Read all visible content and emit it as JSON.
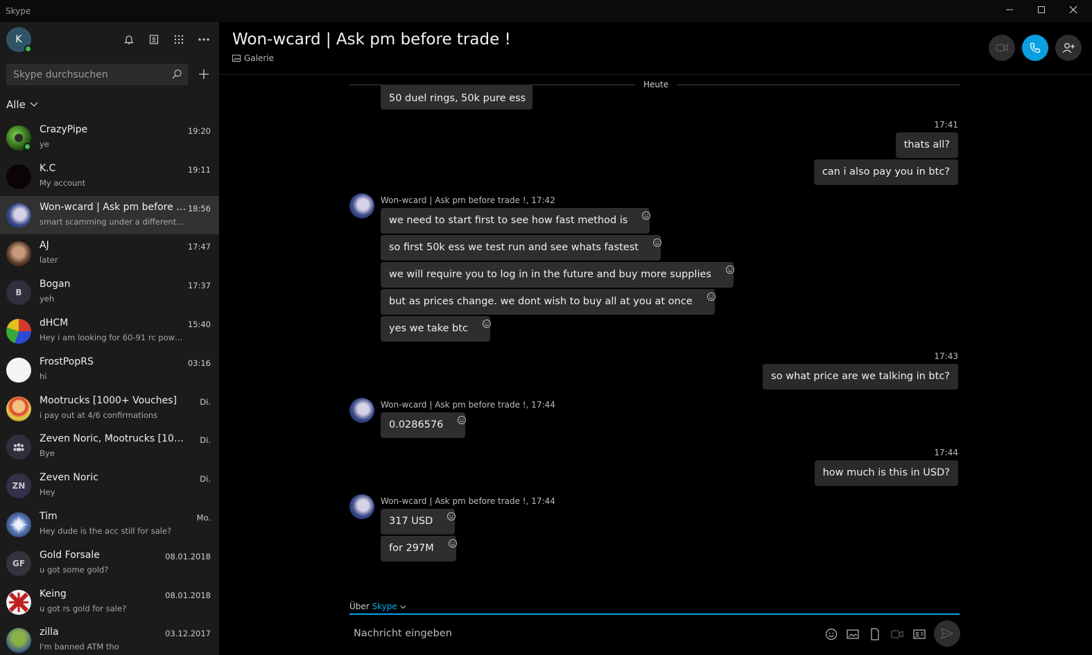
{
  "window": {
    "title": "Skype"
  },
  "sidebar": {
    "me_initial": "K",
    "search_placeholder": "Skype durchsuchen",
    "filter_label": "Alle",
    "contacts": [
      {
        "name": "CrazyPipe",
        "preview": "ye",
        "time": "19:20"
      },
      {
        "name": "K.C",
        "preview": "My account",
        "time": "19:11"
      },
      {
        "name": "Won-wcard | Ask pm before trade !",
        "preview": "smart scamming under a different skype name",
        "time": "18:56"
      },
      {
        "name": "AJ",
        "preview": "later",
        "time": "17:47"
      },
      {
        "name": "Bogan",
        "preview": "yeh",
        "time": "17:37",
        "initials": "B"
      },
      {
        "name": "dHCM",
        "preview": "Hey i am looking for 60-91 rc powerlvl",
        "time": "15:40"
      },
      {
        "name": "FrostPopRS",
        "preview": "hi",
        "time": "03:16"
      },
      {
        "name": "Mootrucks [1000+ Vouches]",
        "preview": "i pay out at 4/6 confirmations",
        "time": "Di."
      },
      {
        "name": "Zeven Noric, Mootrucks [1000+ Vouches]",
        "preview": "Bye",
        "time": "Di."
      },
      {
        "name": "Zeven Noric",
        "preview": "Hey",
        "time": "Di.",
        "initials": "ZN"
      },
      {
        "name": "Tim",
        "preview": "Hey dude is the acc still for sale?",
        "time": "Mo."
      },
      {
        "name": "Gold Forsale",
        "preview": "u got some gold?",
        "time": "08.01.2018",
        "initials": "GF"
      },
      {
        "name": "Keing",
        "preview": "u got rs gold for sale?",
        "time": "08.01.2018"
      },
      {
        "name": "zilla",
        "preview": "I'm banned ATM tho",
        "time": "03.12.2017"
      }
    ]
  },
  "chat": {
    "title": "Won-wcard | Ask pm before trade !",
    "gallery_label": "Galerie",
    "day_label": "Heute",
    "partial_message": "50 duel rings, 50k pure ess",
    "groups": [
      {
        "dir": "out",
        "time": "17:41",
        "messages": [
          "thats all?",
          "can i also pay you in btc?"
        ]
      },
      {
        "dir": "in",
        "meta": "Won-wcard | Ask pm before trade !, 17:42",
        "messages": [
          "we need to start first to see how fast method is",
          "so first 50k ess we test run and see whats fastest",
          "we will require you to log in in the future and buy more supplies",
          "but as prices change. we dont wish to buy all at you at once",
          "yes we take btc"
        ]
      },
      {
        "dir": "out",
        "time": "17:43",
        "messages": [
          "so what price are we talking in btc?"
        ]
      },
      {
        "dir": "in",
        "meta": "Won-wcard | Ask pm before trade !, 17:44",
        "messages": [
          "0.0286576"
        ]
      },
      {
        "dir": "out",
        "time": "17:44",
        "messages": [
          "how much is this in USD?"
        ]
      },
      {
        "dir": "in",
        "meta": "Won-wcard | Ask pm before trade !, 17:44",
        "messages": [
          "317 USD",
          "for 297M"
        ]
      }
    ]
  },
  "composer": {
    "via_prefix": "Über",
    "via_service": "Skype",
    "placeholder": "Nachricht eingeben"
  },
  "colors": {
    "accent": "#00aff0",
    "call_button": "#0aa0e0",
    "online": "#3bc24a"
  }
}
